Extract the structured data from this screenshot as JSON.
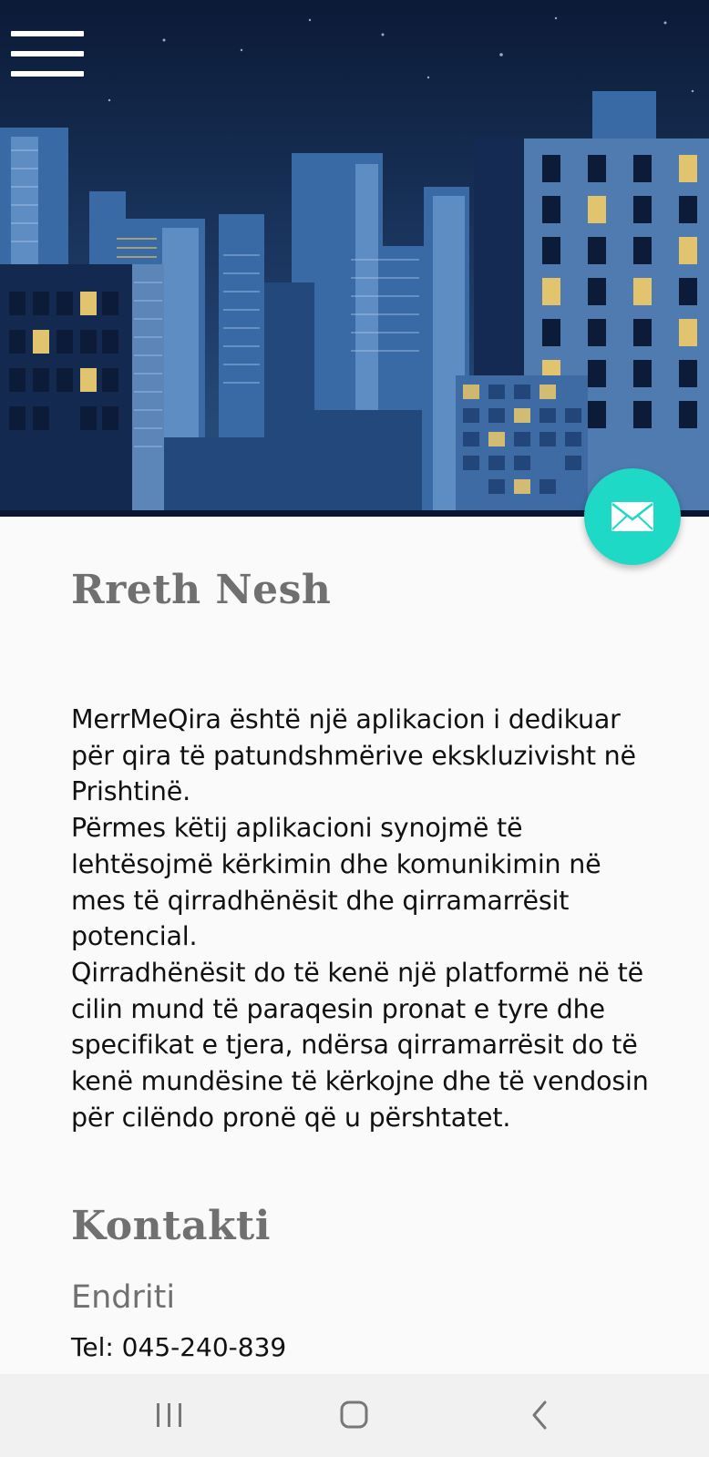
{
  "hero": {
    "icons": {
      "menu": "hamburger-menu-icon",
      "fab": "envelope-icon"
    }
  },
  "about": {
    "heading": "Rreth Nesh",
    "paragraphs": [
      "MerrMeQira është një aplikacion i dedikuar për qira të patundshmërive ekskluzivisht në Prishtinë.",
      "Përmes këtij aplikacioni synojmë të lehtësojmë kërkimin dhe komunikimin në mes të qirradhënësit dhe qirramarrësit potencial.",
      "Qirradhënësit do të kenë një platformë në të cilin mund të paraqesin pronat e tyre dhe specifikat e tjera, ndërsa qirramarrësit do të kenë mundësine të kërkojne dhe të vendosin për cilëndo pronë që u përshtatet."
    ]
  },
  "contact": {
    "heading": "Kontakti",
    "name": "Endriti",
    "tel": "Tel: 045-240-839"
  },
  "navbar": {
    "icons": [
      "recent-apps-icon",
      "home-icon",
      "back-icon"
    ]
  },
  "colors": {
    "fab": "#1dd9c5",
    "heading": "#707070",
    "sky_top": "#0b1a36",
    "sky_bottom": "#2a5585"
  }
}
